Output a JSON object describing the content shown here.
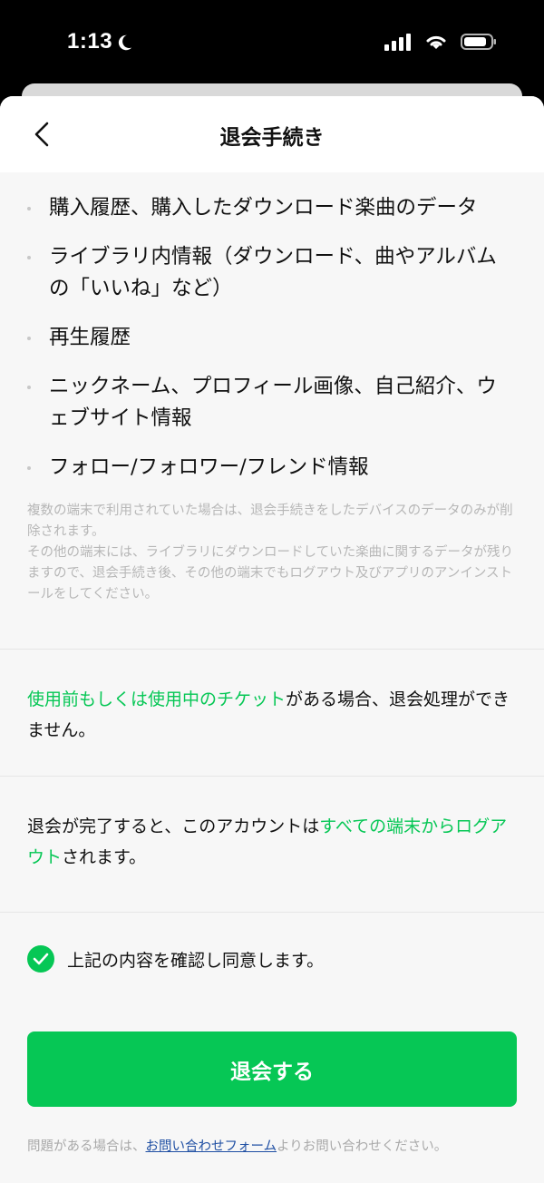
{
  "status_bar": {
    "time": "1:13"
  },
  "header": {
    "title": "退会手続き"
  },
  "lost_items": [
    "購入履歴、購入したダウンロード楽曲のデータ",
    "ライブラリ内情報（ダウンロード、曲やアルバムの「いいね」など）",
    "再生履歴",
    "ニックネーム、プロフィール画像、自己紹介、ウェブサイト情報",
    "フォロー/フォロワー/フレンド情報"
  ],
  "note": {
    "line1": "複数の端末で利用されていた場合は、退会手続きをしたデバイスのデータのみが削除されます。",
    "line2": "その他の端末には、ライブラリにダウンロードしていた楽曲に関するデータが残りますので、退会手続き後、その他の端末でもログアウト及びアプリのアンインストールをしてください。"
  },
  "ticket_notice": {
    "highlight": "使用前もしくは使用中のチケット",
    "rest": "がある場合、退会処理ができません。"
  },
  "logout_notice": {
    "prefix": "退会が完了すると、このアカウントは",
    "highlight": "すべての端末からログアウト",
    "suffix": "されます。"
  },
  "agreement": {
    "label": "上記の内容を確認し同意します。"
  },
  "submit_button": {
    "label": "退会する"
  },
  "footer": {
    "prefix": "問題がある場合は、",
    "link": "お問い合わせフォーム",
    "suffix": "よりお問い合わせください。"
  },
  "colors": {
    "accent": "#06c755",
    "link": "#1f4fa3"
  }
}
